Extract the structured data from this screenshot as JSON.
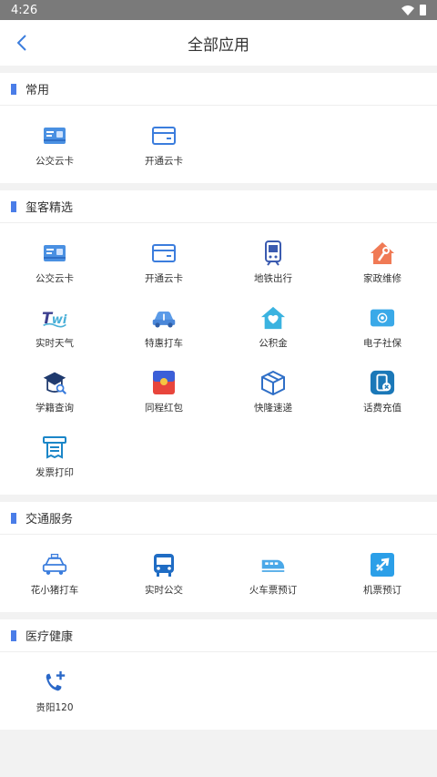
{
  "status": {
    "time": "4:26"
  },
  "header": {
    "title": "全部应用"
  },
  "sections": [
    {
      "title": "常用",
      "items": [
        {
          "label": "公交云卡",
          "icon": "bus-card-icon"
        },
        {
          "label": "开通云卡",
          "icon": "open-card-icon"
        }
      ]
    },
    {
      "title": "玺客精选",
      "items": [
        {
          "label": "公交云卡",
          "icon": "bus-card-icon"
        },
        {
          "label": "开通云卡",
          "icon": "open-card-icon"
        },
        {
          "label": "地铁出行",
          "icon": "metro-icon"
        },
        {
          "label": "家政维修",
          "icon": "home-repair-icon"
        },
        {
          "label": "实时天气",
          "icon": "weather-icon"
        },
        {
          "label": "特惠打车",
          "icon": "car-icon"
        },
        {
          "label": "公积金",
          "icon": "fund-icon"
        },
        {
          "label": "电子社保",
          "icon": "social-security-icon"
        },
        {
          "label": "学籍查询",
          "icon": "graduation-icon"
        },
        {
          "label": "同程红包",
          "icon": "red-packet-icon"
        },
        {
          "label": "快隆速递",
          "icon": "package-icon"
        },
        {
          "label": "话费充值",
          "icon": "phone-recharge-icon"
        },
        {
          "label": "发票打印",
          "icon": "invoice-icon"
        }
      ]
    },
    {
      "title": "交通服务",
      "items": [
        {
          "label": "花小猪打车",
          "icon": "taxi-icon"
        },
        {
          "label": "实时公交",
          "icon": "bus-icon"
        },
        {
          "label": "火车票预订",
          "icon": "train-icon"
        },
        {
          "label": "机票预订",
          "icon": "plane-icon"
        }
      ]
    },
    {
      "title": "医疗健康",
      "items": [
        {
          "label": "贵阳120",
          "icon": "phone-plus-icon"
        }
      ]
    }
  ]
}
